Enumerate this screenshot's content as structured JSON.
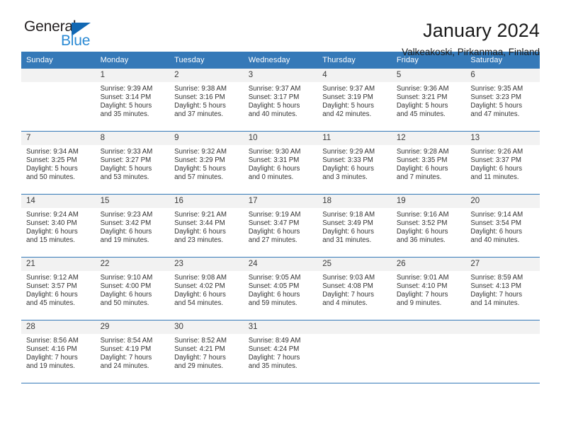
{
  "brand": {
    "name_top": "General",
    "name_bottom": "Blue",
    "triangle_icon": "triangle-icon",
    "color_dark": "#231f20",
    "color_blue": "#2b8ad4",
    "triangle_color": "#1268b3"
  },
  "header": {
    "title": "January 2024",
    "subtitle": "Valkeakoski, Pirkanmaa, Finland"
  },
  "theme": {
    "header_bg": "#3579b8",
    "header_text": "#ffffff",
    "daynum_bg": "#f2f2f2",
    "cell_bg": "#ffffff",
    "rule_color": "#3579b8"
  },
  "calendar": {
    "weekday_headers": [
      "Sunday",
      "Monday",
      "Tuesday",
      "Wednesday",
      "Thursday",
      "Friday",
      "Saturday"
    ],
    "weeks": [
      [
        {
          "day": "",
          "sunrise": "",
          "sunset": "",
          "daylight_line1": "",
          "daylight_line2": "",
          "empty": true
        },
        {
          "day": "1",
          "sunrise": "Sunrise: 9:39 AM",
          "sunset": "Sunset: 3:14 PM",
          "daylight_line1": "Daylight: 5 hours",
          "daylight_line2": "and 35 minutes.",
          "empty": false
        },
        {
          "day": "2",
          "sunrise": "Sunrise: 9:38 AM",
          "sunset": "Sunset: 3:16 PM",
          "daylight_line1": "Daylight: 5 hours",
          "daylight_line2": "and 37 minutes.",
          "empty": false
        },
        {
          "day": "3",
          "sunrise": "Sunrise: 9:37 AM",
          "sunset": "Sunset: 3:17 PM",
          "daylight_line1": "Daylight: 5 hours",
          "daylight_line2": "and 40 minutes.",
          "empty": false
        },
        {
          "day": "4",
          "sunrise": "Sunrise: 9:37 AM",
          "sunset": "Sunset: 3:19 PM",
          "daylight_line1": "Daylight: 5 hours",
          "daylight_line2": "and 42 minutes.",
          "empty": false
        },
        {
          "day": "5",
          "sunrise": "Sunrise: 9:36 AM",
          "sunset": "Sunset: 3:21 PM",
          "daylight_line1": "Daylight: 5 hours",
          "daylight_line2": "and 45 minutes.",
          "empty": false
        },
        {
          "day": "6",
          "sunrise": "Sunrise: 9:35 AM",
          "sunset": "Sunset: 3:23 PM",
          "daylight_line1": "Daylight: 5 hours",
          "daylight_line2": "and 47 minutes.",
          "empty": false
        }
      ],
      [
        {
          "day": "7",
          "sunrise": "Sunrise: 9:34 AM",
          "sunset": "Sunset: 3:25 PM",
          "daylight_line1": "Daylight: 5 hours",
          "daylight_line2": "and 50 minutes.",
          "empty": false
        },
        {
          "day": "8",
          "sunrise": "Sunrise: 9:33 AM",
          "sunset": "Sunset: 3:27 PM",
          "daylight_line1": "Daylight: 5 hours",
          "daylight_line2": "and 53 minutes.",
          "empty": false
        },
        {
          "day": "9",
          "sunrise": "Sunrise: 9:32 AM",
          "sunset": "Sunset: 3:29 PM",
          "daylight_line1": "Daylight: 5 hours",
          "daylight_line2": "and 57 minutes.",
          "empty": false
        },
        {
          "day": "10",
          "sunrise": "Sunrise: 9:30 AM",
          "sunset": "Sunset: 3:31 PM",
          "daylight_line1": "Daylight: 6 hours",
          "daylight_line2": "and 0 minutes.",
          "empty": false
        },
        {
          "day": "11",
          "sunrise": "Sunrise: 9:29 AM",
          "sunset": "Sunset: 3:33 PM",
          "daylight_line1": "Daylight: 6 hours",
          "daylight_line2": "and 3 minutes.",
          "empty": false
        },
        {
          "day": "12",
          "sunrise": "Sunrise: 9:28 AM",
          "sunset": "Sunset: 3:35 PM",
          "daylight_line1": "Daylight: 6 hours",
          "daylight_line2": "and 7 minutes.",
          "empty": false
        },
        {
          "day": "13",
          "sunrise": "Sunrise: 9:26 AM",
          "sunset": "Sunset: 3:37 PM",
          "daylight_line1": "Daylight: 6 hours",
          "daylight_line2": "and 11 minutes.",
          "empty": false
        }
      ],
      [
        {
          "day": "14",
          "sunrise": "Sunrise: 9:24 AM",
          "sunset": "Sunset: 3:40 PM",
          "daylight_line1": "Daylight: 6 hours",
          "daylight_line2": "and 15 minutes.",
          "empty": false
        },
        {
          "day": "15",
          "sunrise": "Sunrise: 9:23 AM",
          "sunset": "Sunset: 3:42 PM",
          "daylight_line1": "Daylight: 6 hours",
          "daylight_line2": "and 19 minutes.",
          "empty": false
        },
        {
          "day": "16",
          "sunrise": "Sunrise: 9:21 AM",
          "sunset": "Sunset: 3:44 PM",
          "daylight_line1": "Daylight: 6 hours",
          "daylight_line2": "and 23 minutes.",
          "empty": false
        },
        {
          "day": "17",
          "sunrise": "Sunrise: 9:19 AM",
          "sunset": "Sunset: 3:47 PM",
          "daylight_line1": "Daylight: 6 hours",
          "daylight_line2": "and 27 minutes.",
          "empty": false
        },
        {
          "day": "18",
          "sunrise": "Sunrise: 9:18 AM",
          "sunset": "Sunset: 3:49 PM",
          "daylight_line1": "Daylight: 6 hours",
          "daylight_line2": "and 31 minutes.",
          "empty": false
        },
        {
          "day": "19",
          "sunrise": "Sunrise: 9:16 AM",
          "sunset": "Sunset: 3:52 PM",
          "daylight_line1": "Daylight: 6 hours",
          "daylight_line2": "and 36 minutes.",
          "empty": false
        },
        {
          "day": "20",
          "sunrise": "Sunrise: 9:14 AM",
          "sunset": "Sunset: 3:54 PM",
          "daylight_line1": "Daylight: 6 hours",
          "daylight_line2": "and 40 minutes.",
          "empty": false
        }
      ],
      [
        {
          "day": "21",
          "sunrise": "Sunrise: 9:12 AM",
          "sunset": "Sunset: 3:57 PM",
          "daylight_line1": "Daylight: 6 hours",
          "daylight_line2": "and 45 minutes.",
          "empty": false
        },
        {
          "day": "22",
          "sunrise": "Sunrise: 9:10 AM",
          "sunset": "Sunset: 4:00 PM",
          "daylight_line1": "Daylight: 6 hours",
          "daylight_line2": "and 50 minutes.",
          "empty": false
        },
        {
          "day": "23",
          "sunrise": "Sunrise: 9:08 AM",
          "sunset": "Sunset: 4:02 PM",
          "daylight_line1": "Daylight: 6 hours",
          "daylight_line2": "and 54 minutes.",
          "empty": false
        },
        {
          "day": "24",
          "sunrise": "Sunrise: 9:05 AM",
          "sunset": "Sunset: 4:05 PM",
          "daylight_line1": "Daylight: 6 hours",
          "daylight_line2": "and 59 minutes.",
          "empty": false
        },
        {
          "day": "25",
          "sunrise": "Sunrise: 9:03 AM",
          "sunset": "Sunset: 4:08 PM",
          "daylight_line1": "Daylight: 7 hours",
          "daylight_line2": "and 4 minutes.",
          "empty": false
        },
        {
          "day": "26",
          "sunrise": "Sunrise: 9:01 AM",
          "sunset": "Sunset: 4:10 PM",
          "daylight_line1": "Daylight: 7 hours",
          "daylight_line2": "and 9 minutes.",
          "empty": false
        },
        {
          "day": "27",
          "sunrise": "Sunrise: 8:59 AM",
          "sunset": "Sunset: 4:13 PM",
          "daylight_line1": "Daylight: 7 hours",
          "daylight_line2": "and 14 minutes.",
          "empty": false
        }
      ],
      [
        {
          "day": "28",
          "sunrise": "Sunrise: 8:56 AM",
          "sunset": "Sunset: 4:16 PM",
          "daylight_line1": "Daylight: 7 hours",
          "daylight_line2": "and 19 minutes.",
          "empty": false
        },
        {
          "day": "29",
          "sunrise": "Sunrise: 8:54 AM",
          "sunset": "Sunset: 4:19 PM",
          "daylight_line1": "Daylight: 7 hours",
          "daylight_line2": "and 24 minutes.",
          "empty": false
        },
        {
          "day": "30",
          "sunrise": "Sunrise: 8:52 AM",
          "sunset": "Sunset: 4:21 PM",
          "daylight_line1": "Daylight: 7 hours",
          "daylight_line2": "and 29 minutes.",
          "empty": false
        },
        {
          "day": "31",
          "sunrise": "Sunrise: 8:49 AM",
          "sunset": "Sunset: 4:24 PM",
          "daylight_line1": "Daylight: 7 hours",
          "daylight_line2": "and 35 minutes.",
          "empty": false
        },
        {
          "day": "",
          "sunrise": "",
          "sunset": "",
          "daylight_line1": "",
          "daylight_line2": "",
          "empty": true
        },
        {
          "day": "",
          "sunrise": "",
          "sunset": "",
          "daylight_line1": "",
          "daylight_line2": "",
          "empty": true
        },
        {
          "day": "",
          "sunrise": "",
          "sunset": "",
          "daylight_line1": "",
          "daylight_line2": "",
          "empty": true
        }
      ]
    ]
  }
}
